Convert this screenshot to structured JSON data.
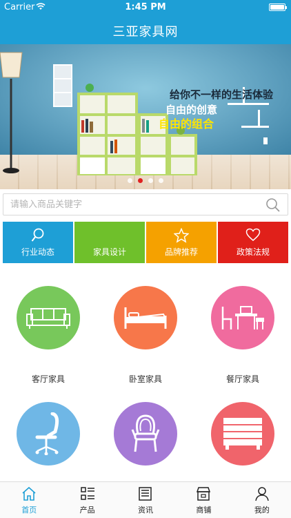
{
  "status_bar": {
    "carrier": "Carrier",
    "time": "1:45 PM"
  },
  "header": {
    "title": "三亚家具网"
  },
  "banner": {
    "line1": "给你不一样的生活体验",
    "line2": "自由的创意",
    "line3": "自由的组合",
    "dots_count": 4,
    "active_dot": 1
  },
  "search": {
    "placeholder": "请输入商品关键字",
    "value": ""
  },
  "tabs": [
    {
      "label": "行业动态",
      "icon": "search-icon",
      "color": "#1e9fd6"
    },
    {
      "label": "家具设计",
      "icon": "none",
      "color": "#6fc02b"
    },
    {
      "label": "品牌推荐",
      "icon": "star-icon",
      "color": "#f5a100"
    },
    {
      "label": "政策法规",
      "icon": "heart-icon",
      "color": "#e0201a"
    }
  ],
  "categories": [
    {
      "label": "客厅家具",
      "icon": "sofa-icon",
      "color": "#78c85b"
    },
    {
      "label": "卧室家具",
      "icon": "bed-icon",
      "color": "#f7774a"
    },
    {
      "label": "餐厅家具",
      "icon": "dining-table-icon",
      "color": "#f06b9e"
    },
    {
      "label": "",
      "icon": "office-chair-icon",
      "color": "#6fb7e6"
    },
    {
      "label": "",
      "icon": "armchair-icon",
      "color": "#a57ad6"
    },
    {
      "label": "",
      "icon": "cabinet-icon",
      "color": "#f0646b"
    }
  ],
  "tabbar": [
    {
      "label": "首页",
      "icon": "home-icon",
      "active": true
    },
    {
      "label": "产品",
      "icon": "grid-list-icon",
      "active": false
    },
    {
      "label": "资讯",
      "icon": "news-icon",
      "active": false
    },
    {
      "label": "商铺",
      "icon": "store-icon",
      "active": false
    },
    {
      "label": "我的",
      "icon": "user-icon",
      "active": false
    }
  ],
  "colors": {
    "primary": "#1e9fd6",
    "text": "#333333"
  }
}
